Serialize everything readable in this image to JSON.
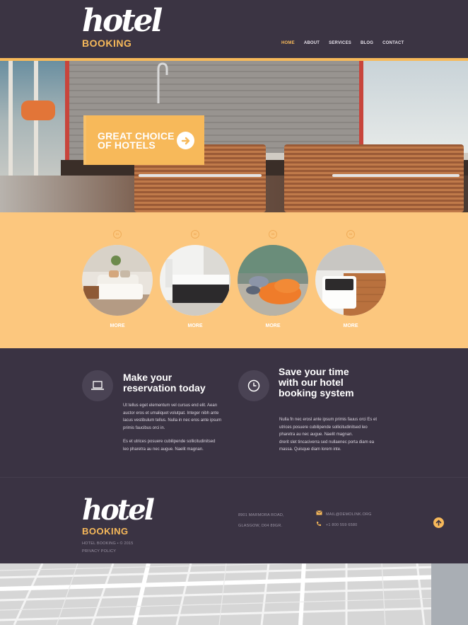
{
  "header": {
    "logo_script": "hotel",
    "logo_word": "BOOKING",
    "nav": [
      "HOME",
      "ABOUT",
      "SERVICES",
      "BLOG",
      "CONTACT"
    ],
    "active_nav": "HOME"
  },
  "hero": {
    "cta_line1": "GREAT CHOICE",
    "cta_line2": "OF HOTELS"
  },
  "services": {
    "items": [
      {
        "num": "01",
        "more": "MORE"
      },
      {
        "num": "02",
        "more": "MORE"
      },
      {
        "num": "03",
        "more": "MORE"
      },
      {
        "num": "04",
        "more": "MORE"
      }
    ]
  },
  "features": {
    "left": {
      "icon": "laptop-icon",
      "title_line1": "Make your",
      "title_line2": "reservation today",
      "p1_l1": "Ut tellus eget elementum vel cursus end elit. Aean",
      "p1_l2": "auctor eros et umaliquet volutpat. Integer nibh ante",
      "p1_l3": "lacus vestibulum tellus. Nulla in nec eros ante ipsum",
      "p1_l4": "primis faucibus orci in.",
      "p2_l1": "Es et utrices posuere cubilipende sollicitudinitsed",
      "p2_l2": "leo pharetra au nec augue. Naelit magnan."
    },
    "right": {
      "icon": "clock-icon",
      "title_line1": "Save your time",
      "title_line2": "with our hotel",
      "title_line3": "booking system",
      "p1_l1": "Nulla fn nec erosl ante ipsum primis fauus orci Es et",
      "p1_l2": "utrices posuere cubilipende sollicitudinitsed leo",
      "p1_l3": "pharetra au nec augue. Naelit magnan.",
      "p1_l4": "drerit slet tincaciverra sed nullaenec porta diam ea",
      "p1_l5": "massa. Quisque diam lorem inte."
    }
  },
  "footer": {
    "logo_script": "hotel",
    "logo_word": "BOOKING",
    "copyright": "HOTEL BOOKING • © 2015",
    "privacy": "PRIVACY POLICY",
    "addr1": "8901 MARMORA ROAD,",
    "addr2": "GLASGOW, D04 89GR.",
    "email": "MAIL@DEMOLINK.ORG",
    "phone": "+1 800 559 6580"
  },
  "colors": {
    "accent": "#f7b95a",
    "dark": "#3a3343",
    "band": "#fcc77e"
  }
}
